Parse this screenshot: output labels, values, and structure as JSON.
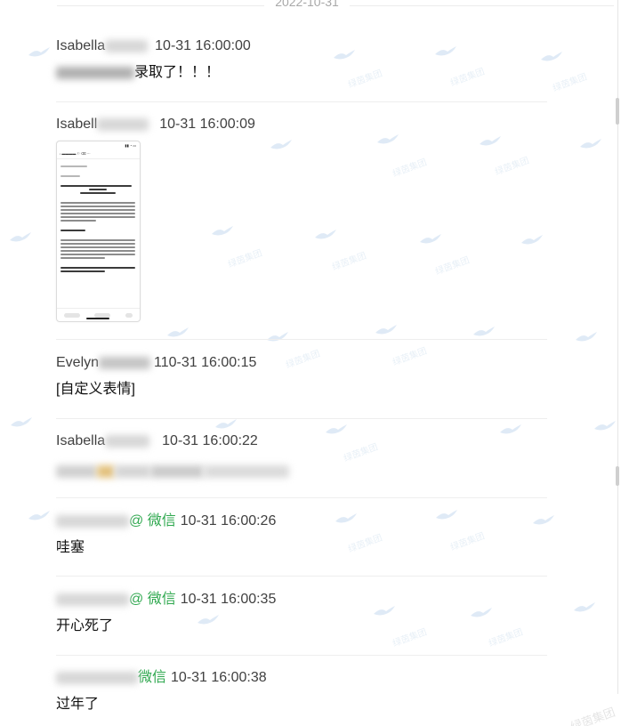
{
  "date_divider": "2022-10-31",
  "messages": [
    {
      "sender": "Isabella",
      "time": "10-31 16:00:00",
      "text": "录取了！！！"
    },
    {
      "sender": "Isabell",
      "time": "10-31 16:00:09",
      "attachment": "image"
    },
    {
      "sender": "Evelyn",
      "time": "10-31 16:00:15",
      "text": "[自定义表情]",
      "time_prefix": "1"
    },
    {
      "sender": "Isabella",
      "time": "10-31 16:00:22"
    },
    {
      "sender": "",
      "wx_label": "@ 微信",
      "time": "10-31 16:00:26",
      "text": "哇塞"
    },
    {
      "sender": "",
      "wx_label": "@ 微信",
      "time": "10-31 16:00:35",
      "text": "开心死了"
    },
    {
      "sender": "",
      "wx_label": "微信",
      "time": "10-31 16:00:38",
      "text": "过年了"
    }
  ],
  "watermark_text": "绿茵集团",
  "colors": {
    "wx_green": "#2fa84f",
    "meta_gray": "#404040",
    "divider": "#eeeeee"
  }
}
